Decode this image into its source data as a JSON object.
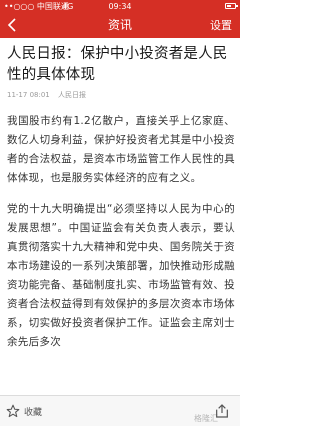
{
  "status_bar": {
    "carrier": "••○○○ 中国联通",
    "network": "4G",
    "time": "09:34",
    "battery_level": 0.45
  },
  "nav": {
    "back_icon": "chevron-left-icon",
    "title": "资讯",
    "settings_label": "设置"
  },
  "article": {
    "headline": "人民日报：保护中小投资者是人民性的具体体现",
    "date": "11-17 08:01",
    "source": "人民日报",
    "paragraphs": [
      "我国股市约有1.2亿散户，直接关乎上亿家庭、数亿人切身利益，保护好投资者尤其是中小投资者的合法权益，是资本市场监管工作人民性的具体体现，也是服务实体经济的应有之义。",
      "党的十九大明确提出“必须坚持以人民为中心的发展思想”。中国证监会有关负责人表示，要认真贯彻落实十九大精神和党中央、国务院关于资本市场建设的一系列决策部署，加快推动形成融资功能完备、基础制度扎实、市场监管有效、投资者合法权益得到有效保护的多层次资本市场体系，切实做好投资者保护工作。证监会主席刘士余先后多次"
    ]
  },
  "bottom_bar": {
    "favorite_label": "收藏",
    "favorite_icon": "star-icon",
    "share_icon": "share-icon",
    "watermark": "格隆汇"
  },
  "colors": {
    "accent": "#d52f25"
  }
}
